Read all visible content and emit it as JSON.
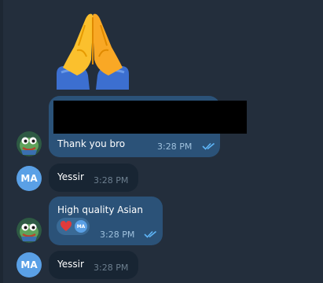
{
  "messages": [
    {
      "text": "Thank you bro",
      "time": "3:28 PM"
    },
    {
      "sender_initials": "MA",
      "text": "Yessir",
      "time": "3:28 PM"
    },
    {
      "text": "High quality Asian",
      "time": "3:28 PM",
      "reaction_avatar_initials": "MA"
    },
    {
      "sender_initials": "MA",
      "text": "Yessir",
      "time": "3:28 PM"
    }
  ],
  "icons": {
    "sticker": "folded-hands-sticker",
    "reaction": "red-heart",
    "read_receipt": "double-checkmark"
  },
  "colors": {
    "background": "#232e3c",
    "outgoing_bubble": "#2b5278",
    "incoming_bubble": "#182533",
    "avatar_ma": "#5aa0e6",
    "check": "#5eb5f7"
  }
}
